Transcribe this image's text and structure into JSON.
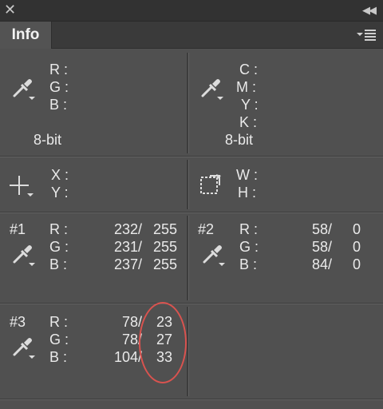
{
  "window": {
    "close_glyph": "✕",
    "collapse_glyph": "◀◀",
    "tab_title": "Info",
    "panel_menu_icon": "panel-menu-icon"
  },
  "color_readout_1": {
    "labels": [
      "R :",
      "G :",
      "B :"
    ],
    "depth": "8-bit"
  },
  "color_readout_2": {
    "labels": [
      "C :",
      "M :",
      "Y :",
      "K :"
    ],
    "depth": "8-bit"
  },
  "position_readout": {
    "labels": [
      "X :",
      "Y :"
    ]
  },
  "size_readout": {
    "labels": [
      "W :",
      "H :"
    ]
  },
  "samplers": [
    {
      "id": "#1",
      "labels": [
        "R :",
        "G :",
        "B :"
      ],
      "before": [
        "232/",
        "231/",
        "237/"
      ],
      "after": [
        "255",
        "255",
        "255"
      ]
    },
    {
      "id": "#2",
      "labels": [
        "R :",
        "G :",
        "B :"
      ],
      "before": [
        "58/",
        "58/",
        "84/"
      ],
      "after": [
        "0",
        "0",
        "0"
      ]
    },
    {
      "id": "#3",
      "labels": [
        "R :",
        "G :",
        "B :"
      ],
      "before": [
        "78/",
        "78/",
        "104/"
      ],
      "after": [
        "23",
        "27",
        "33"
      ]
    }
  ],
  "colors": {
    "panel_bg": "#505050",
    "annotation_circle": "#d9534f"
  },
  "icons": [
    "eyedropper-icon",
    "crosshair-icon",
    "selection-size-icon",
    "panel-menu-icon"
  ]
}
